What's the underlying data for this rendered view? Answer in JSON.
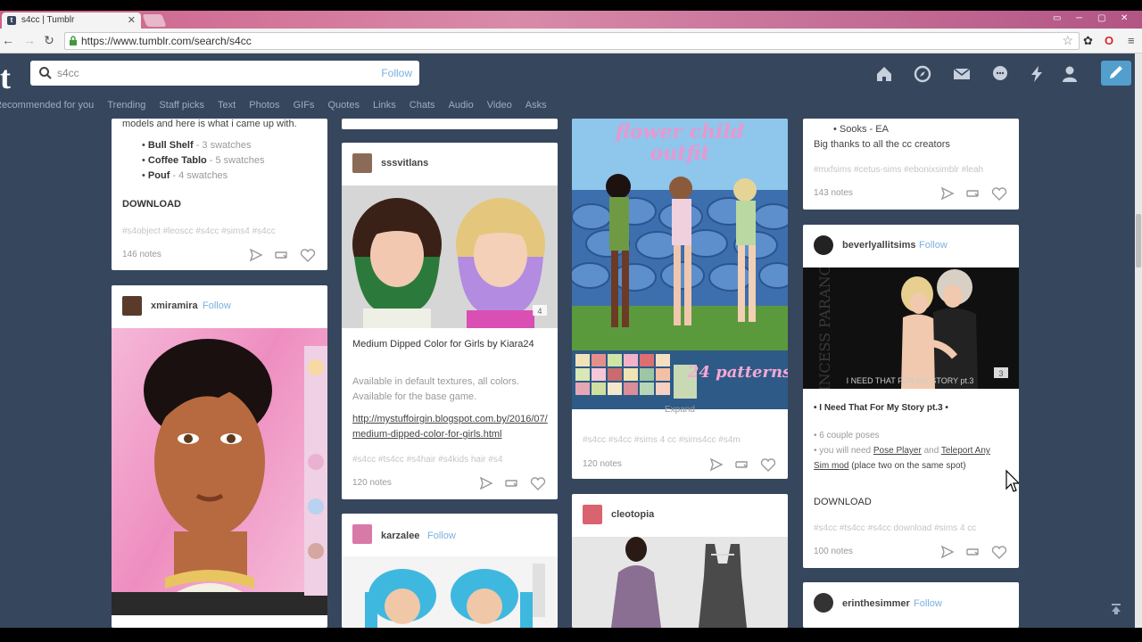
{
  "browser": {
    "tab_title": "s4cc | Tumblr",
    "url": "https://www.tumblr.com/search/s4cc"
  },
  "header": {
    "logo": "t",
    "search_query": "s4cc",
    "search_follow": "Follow",
    "filters": [
      "Recommended for you",
      "Trending",
      "Staff picks",
      "Text",
      "Photos",
      "GIFs",
      "Quotes",
      "Links",
      "Chats",
      "Audio",
      "Video",
      "Asks"
    ]
  },
  "col1": {
    "card1": {
      "intro": "models and here is what i came up with.",
      "items": [
        {
          "name": "Bull Shelf",
          "detail": " - 3 swatches"
        },
        {
          "name": "Coffee Tablo",
          "detail": " - 5 swatches"
        },
        {
          "name": "Pouf",
          "detail": " - 4 swatches"
        }
      ],
      "download": "DOWNLOAD",
      "tags": "#s4object   #leoscc   #s4cc   #sims4   #s4cc",
      "notes": "146 notes"
    },
    "card2": {
      "user": "xmiramira",
      "follow": "Follow"
    }
  },
  "col2": {
    "card1": {
      "user": "sssvitlans",
      "title": "Medium Dipped Color for Girls by Kiara24",
      "body": "Available in  default textures, all colors. Available for the base game.",
      "link": "http://mystuffoirgin.blogspot.com.by/2016/07/medium-dipped-color-for-girls.html",
      "tags": "#s4cc   #ts4cc   #s4hair   #s4kids hair   #s4",
      "notes": "120 notes",
      "badge": "4"
    },
    "card2": {
      "user": "karzalee",
      "follow": "Follow"
    }
  },
  "col3": {
    "card1": {
      "title_line1": "flower child",
      "title_line2": "outfit",
      "patterns": "24 patterns",
      "expand": "Expand",
      "tags": "#s4cc   #s4cc   #sims 4 cc   #sims4cc   #s4m",
      "notes": "120 notes"
    },
    "card2": {
      "user": "cleotopia"
    }
  },
  "col4": {
    "card1": {
      "item": "Sooks - EA",
      "thanks": "Big thanks to all the cc creators",
      "tags": "#mxfsims   #cetus-sims   #ebonixsimblr   #leah",
      "notes": "143 notes"
    },
    "card2": {
      "user": "beverlyallitsims",
      "follow": "Follow",
      "overlay_text": "I NEED THAT FOR MY STORY pt.3",
      "side_text": "PRINCESS PARANOIA",
      "badge": "3",
      "title": "• I Need That For My Story pt.3 •",
      "bullet1": "• 6 couple poses",
      "bullet2_pre": "• you will need ",
      "bullet2_link1": "Pose Player",
      "bullet2_and": " and ",
      "bullet2_link2": "Teleport Any Sim mod",
      "bullet2_post": " (place two on the same spot)",
      "download": "DOWNLOAD",
      "tags": "#s4cc   #ts4cc   #s4cc download   #sims 4 cc",
      "notes": "100 notes"
    },
    "card3": {
      "user": "erinthesimmer",
      "follow": "Follow"
    }
  },
  "colors": {
    "dashboard_bg": "#36465d",
    "accent_blue": "#529ecc",
    "follow_blue": "#7ab0e0"
  }
}
